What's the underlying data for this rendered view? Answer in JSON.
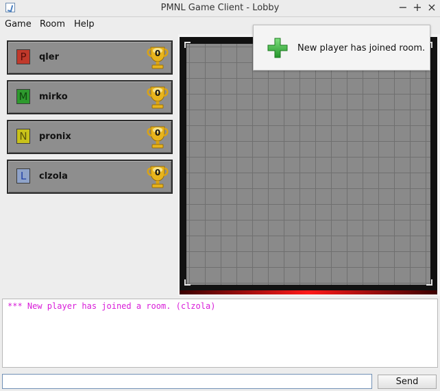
{
  "window": {
    "title": "PMNL Game Client - Lobby",
    "controls": {
      "minimize": "−",
      "maximize": "+",
      "close": "×"
    }
  },
  "menu": [
    "Game",
    "Room",
    "Help"
  ],
  "players": [
    {
      "initial": "P",
      "name": "qler",
      "score": "0",
      "color": "#c0392b"
    },
    {
      "initial": "M",
      "name": "mirko",
      "score": "0",
      "color": "#2e9a2e"
    },
    {
      "initial": "N",
      "name": "pronix",
      "score": "0",
      "color": "#c9c21a"
    },
    {
      "initial": "L",
      "name": "clzola",
      "score": "0",
      "color": "#1f3fa6"
    }
  ],
  "notification": {
    "icon": "plus-icon",
    "message": "New player has joined room."
  },
  "chat": {
    "lines": [
      "*** New player has joined a room. (clzola)"
    ],
    "input_value": "",
    "send_label": "Send"
  },
  "colors": {
    "chat_system": "#d81bd8",
    "board_bg": "#8a8a8a",
    "card_bg": "#8e8e8e",
    "accent_red": "#ff1a1a",
    "plus_green": "#3cae3c"
  }
}
